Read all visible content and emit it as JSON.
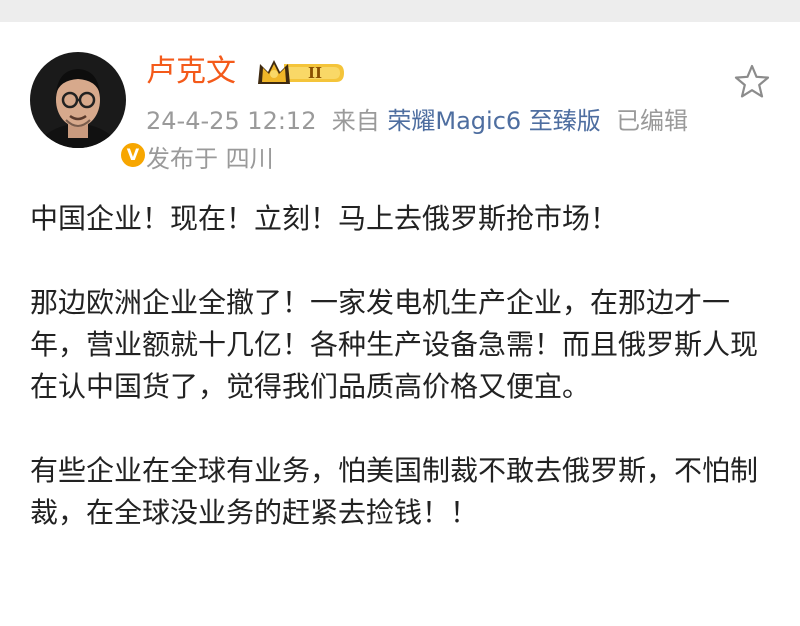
{
  "post": {
    "author": {
      "name": "卢克文",
      "badge_level": "II",
      "verified_mark": "V"
    },
    "meta": {
      "time": "24-4-25 12:12",
      "from_label": "来自",
      "device": "荣耀Magic6 至臻版",
      "edited": "已编辑",
      "location": "发布于 四川"
    },
    "paragraphs": [
      "中国企业！现在！立刻！马上去俄罗斯抢市场！",
      "那边欧洲企业全撤了！一家发电机生产企业，在那边才一年，营业额就十几亿！各种生产设备急需！而且俄罗斯人现在认中国货了，觉得我们品质高价格又便宜。",
      "有些企业在全球有业务，怕美国制裁不敢去俄罗斯，不怕制裁，在全球没业务的赶紧去捡钱！！"
    ],
    "icons": {
      "favorite": "star-icon",
      "avatar": "avatar-icon",
      "vip": "crown-badge-icon"
    },
    "colors": {
      "name": "#f45a1a",
      "source": "#4e6ea0",
      "meta": "#9a9a9a",
      "text": "#222222",
      "badge_gold": "#f7a600"
    }
  }
}
